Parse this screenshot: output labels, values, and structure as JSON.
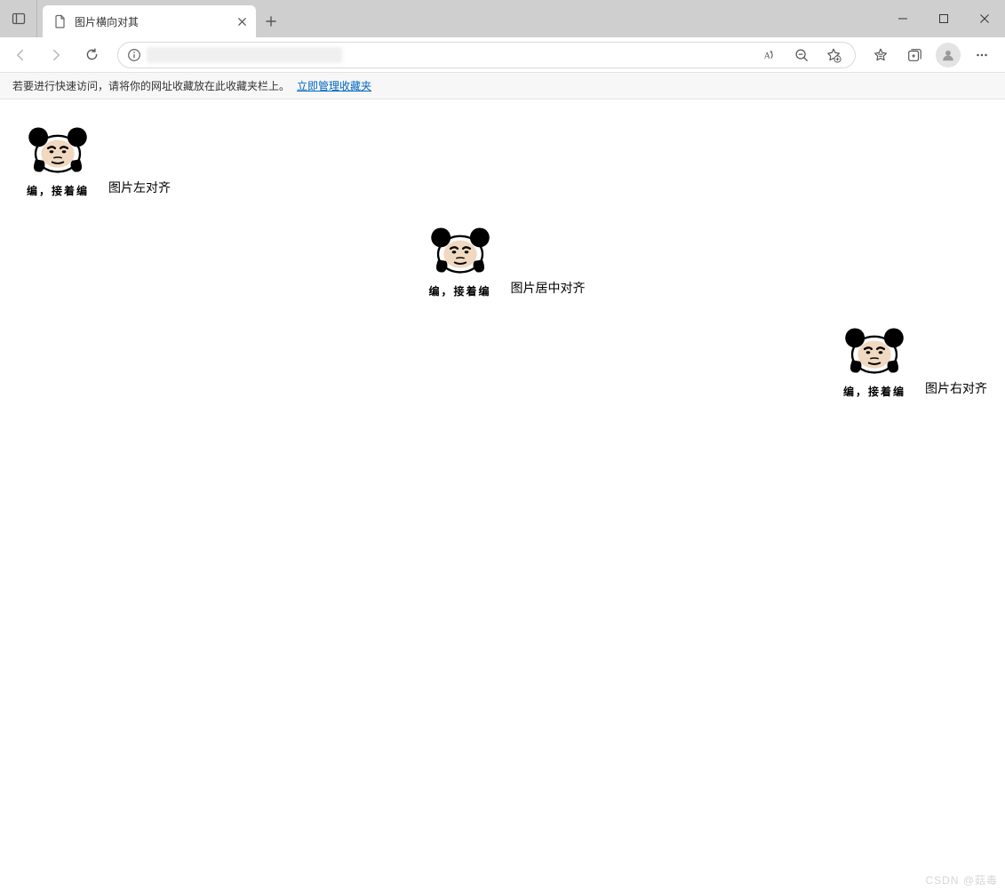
{
  "window": {
    "tab_title": "图片横向对其",
    "new_tab_tooltip": "+"
  },
  "favorites_bar": {
    "prompt_text": "若要进行快速访问，请将你的网址收藏放在此收藏夹栏上。",
    "manage_link": "立即管理收藏夹"
  },
  "content": {
    "meme_caption": "编，接着编",
    "label_left": "图片左对齐",
    "label_center": "图片居中对齐",
    "label_right": "图片右对齐"
  },
  "watermark": "CSDN @菇毒"
}
